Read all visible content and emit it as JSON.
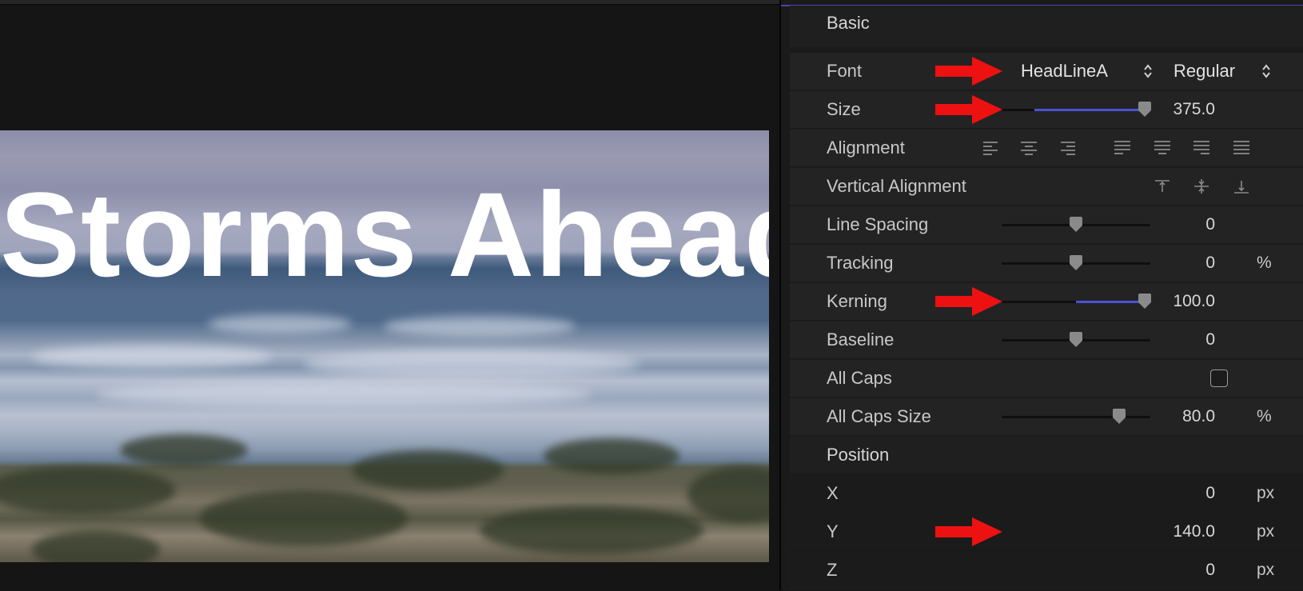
{
  "viewer": {
    "title_text": "Storms Ahead"
  },
  "inspector": {
    "section_basic": "Basic",
    "section_position": "Position",
    "font": {
      "label": "Font",
      "family": "HeadLineA",
      "style": "Regular"
    },
    "size": {
      "label": "Size",
      "value": "375.0",
      "slider_fraction": 0.96,
      "fill_start_fraction": 0.22
    },
    "alignment": {
      "label": "Alignment"
    },
    "vertical_alignment": {
      "label": "Vertical Alignment"
    },
    "line_spacing": {
      "label": "Line Spacing",
      "value": "0",
      "slider_fraction": 0.5
    },
    "tracking": {
      "label": "Tracking",
      "value": "0",
      "unit": "%",
      "slider_fraction": 0.5
    },
    "kerning": {
      "label": "Kerning",
      "value": "100.0",
      "slider_fraction": 0.96,
      "fill_start_fraction": 0.5
    },
    "baseline": {
      "label": "Baseline",
      "value": "0",
      "slider_fraction": 0.5
    },
    "all_caps": {
      "label": "All Caps",
      "checked": false
    },
    "all_caps_size": {
      "label": "All Caps Size",
      "value": "80.0",
      "unit": "%",
      "slider_fraction": 0.79
    },
    "x": {
      "label": "X",
      "value": "0",
      "unit": "px"
    },
    "y": {
      "label": "Y",
      "value": "140.0",
      "unit": "px"
    },
    "z": {
      "label": "Z",
      "value": "0",
      "unit": "px"
    }
  },
  "colors": {
    "accent": "#4446a8",
    "slider_fill": "#4a52d6",
    "arrow": "#ee1111",
    "panel_bg": "#232323"
  },
  "icons": [
    "updown-chevron-icon",
    "slider-knob-icon",
    "align-left-icon",
    "align-center-icon",
    "align-right-icon",
    "justify-left-icon",
    "justify-center-icon",
    "justify-right-icon",
    "justify-full-icon",
    "valign-top-icon",
    "valign-middle-icon",
    "valign-bottom-icon",
    "red-arrow-icon"
  ]
}
